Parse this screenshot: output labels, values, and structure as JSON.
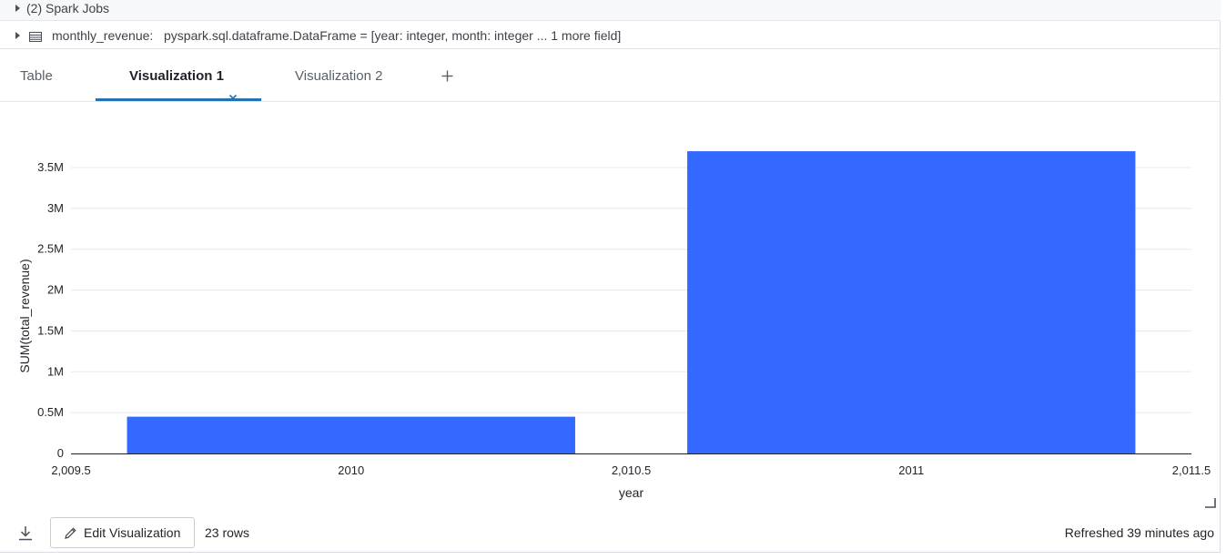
{
  "spark_jobs": {
    "label": "(2) Spark Jobs"
  },
  "dataframe": {
    "name": "monthly_revenue:",
    "schema": "pyspark.sql.dataframe.DataFrame = [year: integer, month: integer ... 1 more field]"
  },
  "tabs": [
    {
      "label": "Table",
      "active": false
    },
    {
      "label": "Visualization 1",
      "active": true
    },
    {
      "label": "Visualization 2",
      "active": false
    }
  ],
  "add_tab_icon": "plus-icon",
  "chart_data": {
    "type": "bar",
    "x": [
      2010,
      2011
    ],
    "values": [
      450000,
      3700000
    ],
    "xlabel": "year",
    "ylabel": "SUM(total_revenue)",
    "xlim": [
      2009.5,
      2011.5
    ],
    "ylim": [
      0,
      3900000
    ],
    "xticks": [
      2009.5,
      2010,
      2010.5,
      2011,
      2011.5
    ],
    "xtick_labels": [
      "2,009.5",
      "2010",
      "2,010.5",
      "2011",
      "2,011.5"
    ],
    "yticks": [
      0,
      500000,
      1000000,
      1500000,
      2000000,
      2500000,
      3000000,
      3500000
    ],
    "ytick_labels": [
      "0",
      "0.5M",
      "1M",
      "1.5M",
      "2M",
      "2.5M",
      "3M",
      "3.5M"
    ],
    "bar_color": "#3469ff",
    "grid": true
  },
  "footer": {
    "download_icon": "download-icon",
    "edit_label": "Edit Visualization",
    "rows_label": "23 rows",
    "refreshed_label": "Refreshed 39 minutes ago"
  }
}
